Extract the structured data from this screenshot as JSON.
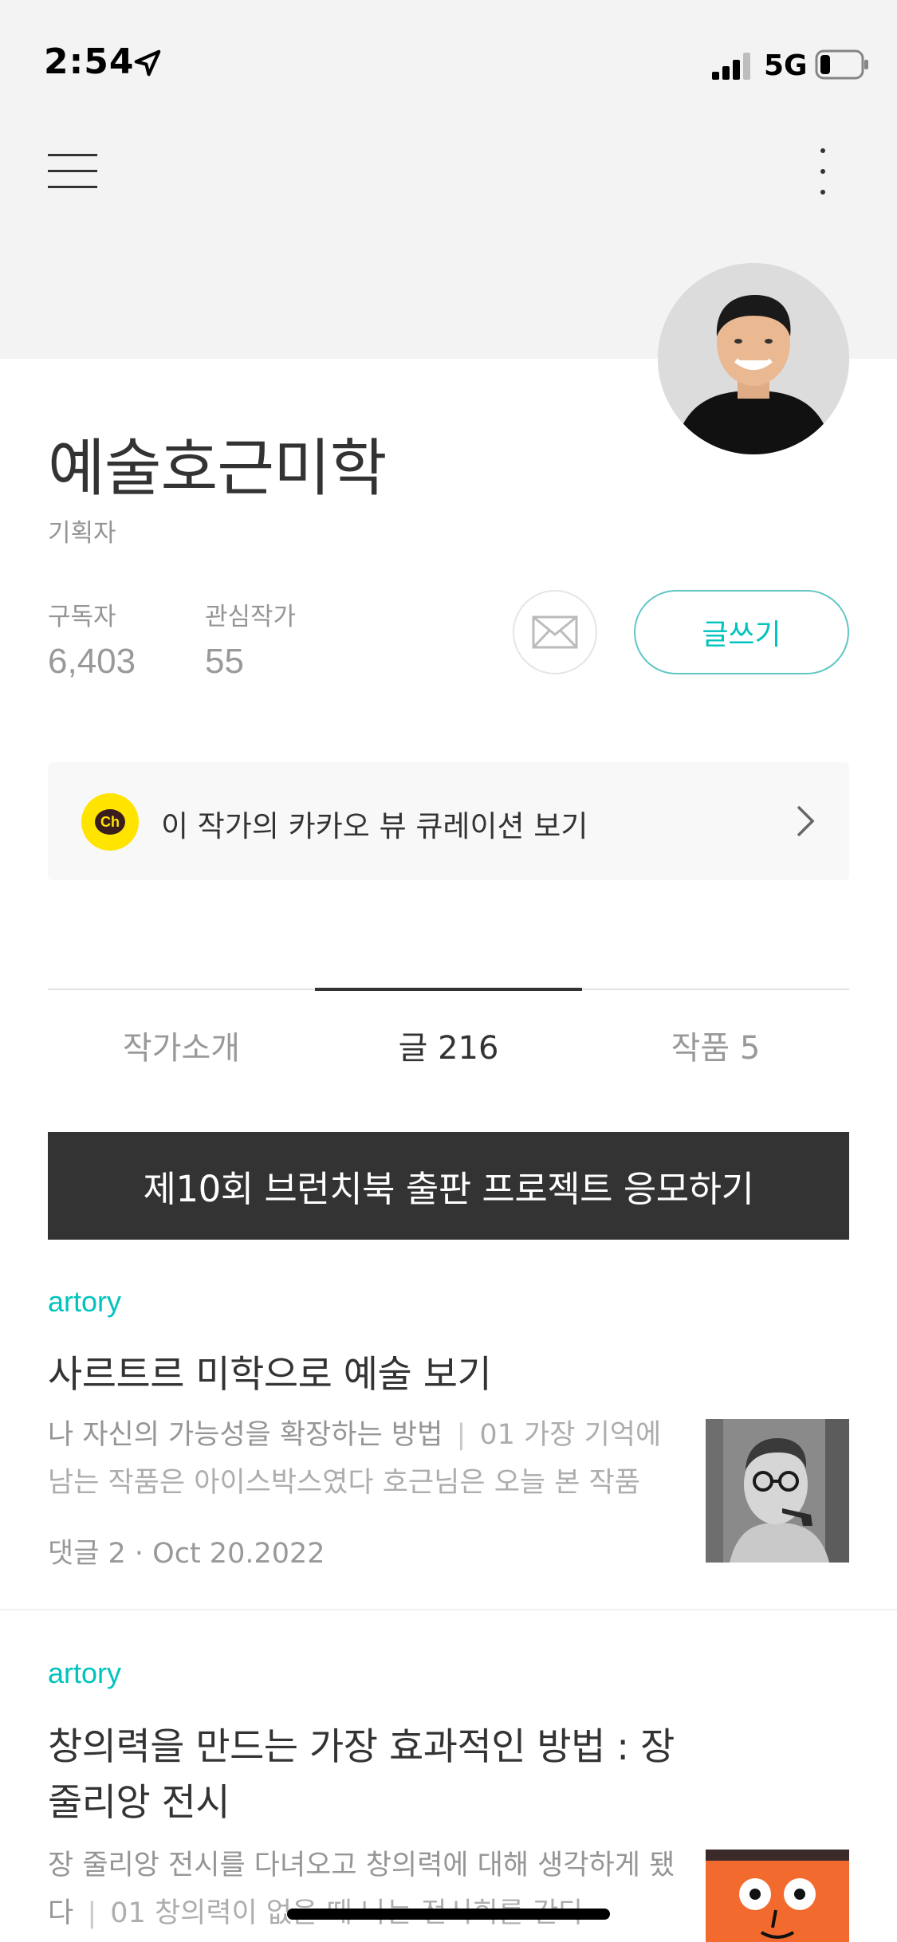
{
  "status_bar": {
    "time": "2:54",
    "network": "5G"
  },
  "profile": {
    "name": "예술호근미학",
    "role": "기획자",
    "stats": [
      {
        "label": "구독자",
        "value": "6,403"
      },
      {
        "label": "관심작가",
        "value": "55"
      }
    ],
    "write_label": "글쓰기"
  },
  "curation": {
    "badge": "Ch",
    "text": "이 작가의 카카오 뷰 큐레이션 보기"
  },
  "tabs": [
    {
      "label": "작가소개",
      "active": false
    },
    {
      "label": "글 216",
      "active": true
    },
    {
      "label": "작품 5",
      "active": false
    }
  ],
  "banner": {
    "text": "제10회 브런치북 출판 프로젝트 응모하기"
  },
  "articles": [
    {
      "magazine": "artory",
      "title": "사르트르 미학으로 예술 보기",
      "summary_lead": "나 자신의 가능성을 확장하는 방법",
      "summary_sep": "|",
      "summary_body": "01 가장 기억에 남는 작품은 아이스박스였다 호근님은 오늘 본 작품",
      "meta": "댓글 2 · Oct 20.2022"
    },
    {
      "magazine": "artory",
      "title": "창의력을 만드는 가장 효과적인 방법 : 장 줄리앙 전시",
      "summary_lead": "장 줄리앙 전시를 다녀오고 창의력에 대해 생각하게 됐다",
      "summary_sep": "|",
      "summary_body": "01 창의력이 없을 때 나는 전시회를 간다"
    }
  ],
  "colors": {
    "accent": "#00c3bd",
    "banner_bg": "#333333",
    "kakao_yellow": "#ffe400"
  }
}
